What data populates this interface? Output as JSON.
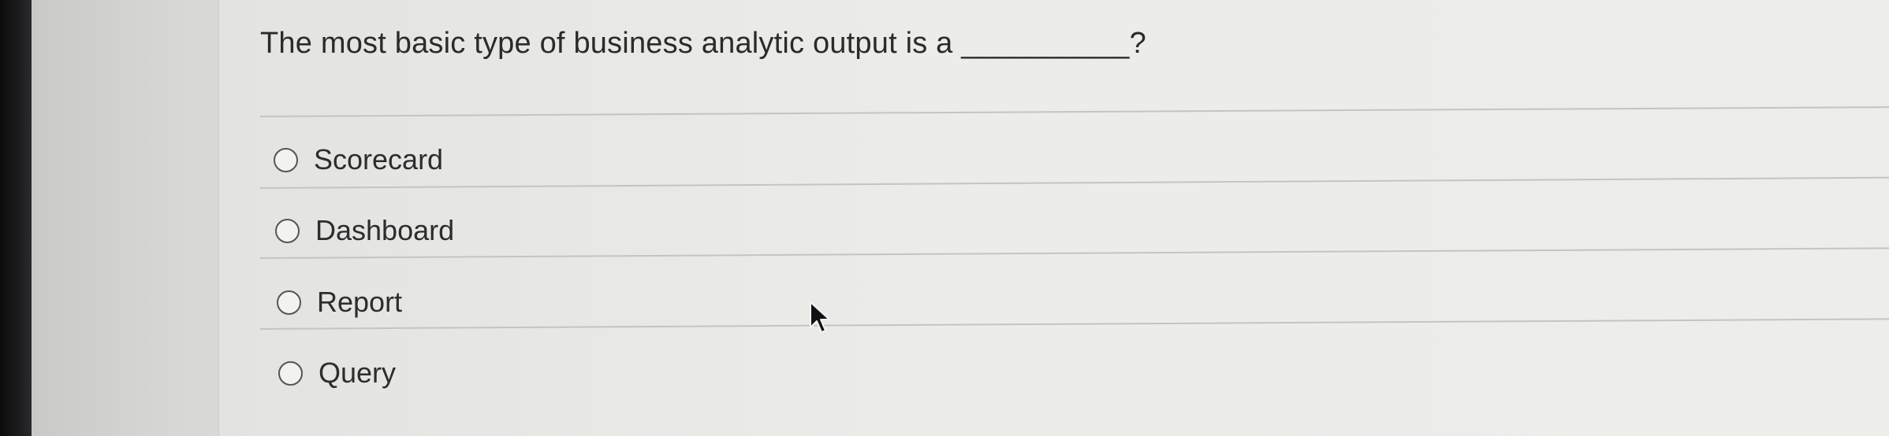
{
  "question": {
    "text": "The most basic type of business analytic output is a __________?"
  },
  "options": [
    {
      "label": "Scorecard",
      "selected": false
    },
    {
      "label": "Dashboard",
      "selected": false
    },
    {
      "label": "Report",
      "selected": false
    },
    {
      "label": "Query",
      "selected": false
    }
  ],
  "icons": {
    "cursor": "mouse-pointer-icon",
    "radio": "radio-button-icon"
  }
}
